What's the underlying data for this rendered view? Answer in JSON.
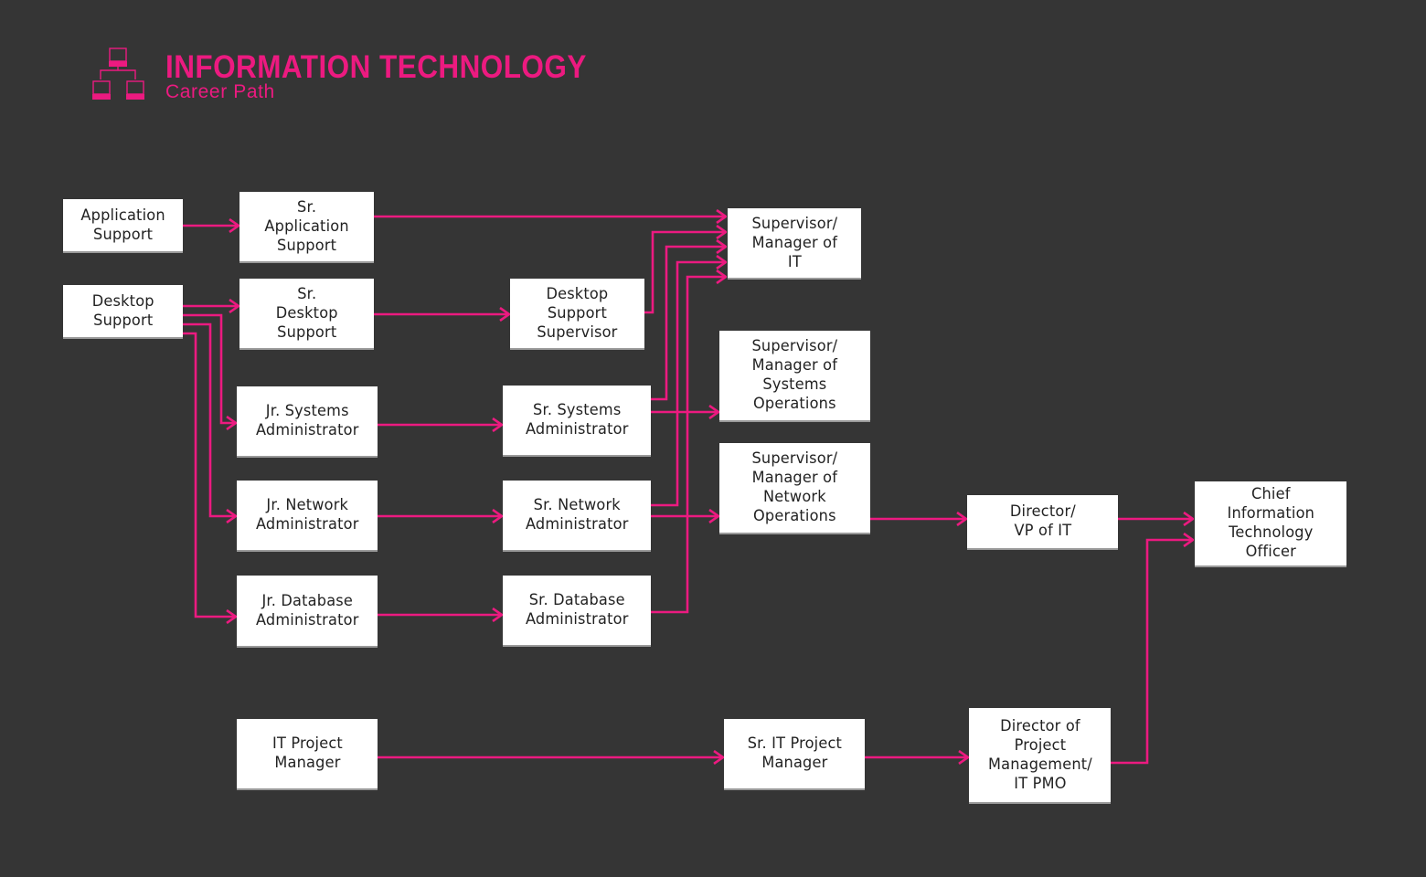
{
  "header": {
    "title": "INFORMATION TECHNOLOGY",
    "subtitle": "Career Path",
    "icon": "network-computers-icon"
  },
  "colors": {
    "background": "#353535",
    "accent": "#ec1a80",
    "node_fill": "#ffffff",
    "node_text": "#222222"
  },
  "nodes": {
    "application_support": "Application\nSupport",
    "sr_application_support": "Sr.\nApplication\nSupport",
    "desktop_support": "Desktop\nSupport",
    "sr_desktop_support": "Sr.\nDesktop\nSupport",
    "desktop_support_supervisor": "Desktop\nSupport\nSupervisor",
    "jr_systems_admin": "Jr. Systems\nAdministrator",
    "sr_systems_admin": "Sr. Systems\nAdministrator",
    "jr_network_admin": "Jr. Network\nAdministrator",
    "sr_network_admin": "Sr. Network\nAdministrator",
    "jr_database_admin": "Jr. Database\nAdministrator",
    "sr_database_admin": "Sr. Database\nAdministrator",
    "supervisor_manager_it": "Supervisor/\nManager of\nIT",
    "supervisor_manager_systems_ops": "Supervisor/\nManager of\nSystems\nOperations",
    "supervisor_manager_network_ops": "Supervisor/\nManager of\nNetwork\nOperations",
    "director_vp_it": "Director/\nVP of IT",
    "cito": "Chief\nInformation\nTechnology\nOfficer",
    "it_project_manager": "IT Project\nManager",
    "sr_it_project_manager": "Sr. IT Project\nManager",
    "director_pmo": "Director of\nProject\nManagement/\nIT PMO"
  },
  "edges": [
    [
      "application_support",
      "sr_application_support"
    ],
    [
      "sr_application_support",
      "supervisor_manager_it"
    ],
    [
      "desktop_support",
      "sr_desktop_support"
    ],
    [
      "desktop_support",
      "jr_systems_admin"
    ],
    [
      "desktop_support",
      "jr_network_admin"
    ],
    [
      "desktop_support",
      "jr_database_admin"
    ],
    [
      "sr_desktop_support",
      "desktop_support_supervisor"
    ],
    [
      "desktop_support_supervisor",
      "supervisor_manager_it"
    ],
    [
      "jr_systems_admin",
      "sr_systems_admin"
    ],
    [
      "jr_network_admin",
      "sr_network_admin"
    ],
    [
      "jr_database_admin",
      "sr_database_admin"
    ],
    [
      "sr_systems_admin",
      "supervisor_manager_it"
    ],
    [
      "sr_network_admin",
      "supervisor_manager_it"
    ],
    [
      "sr_database_admin",
      "supervisor_manager_it"
    ],
    [
      "sr_systems_admin",
      "supervisor_manager_systems_ops"
    ],
    [
      "sr_network_admin",
      "supervisor_manager_network_ops"
    ],
    [
      "supervisor_manager_network_ops",
      "director_vp_it"
    ],
    [
      "director_vp_it",
      "cito"
    ],
    [
      "it_project_manager",
      "sr_it_project_manager"
    ],
    [
      "sr_it_project_manager",
      "director_pmo"
    ],
    [
      "director_pmo",
      "cito"
    ]
  ]
}
